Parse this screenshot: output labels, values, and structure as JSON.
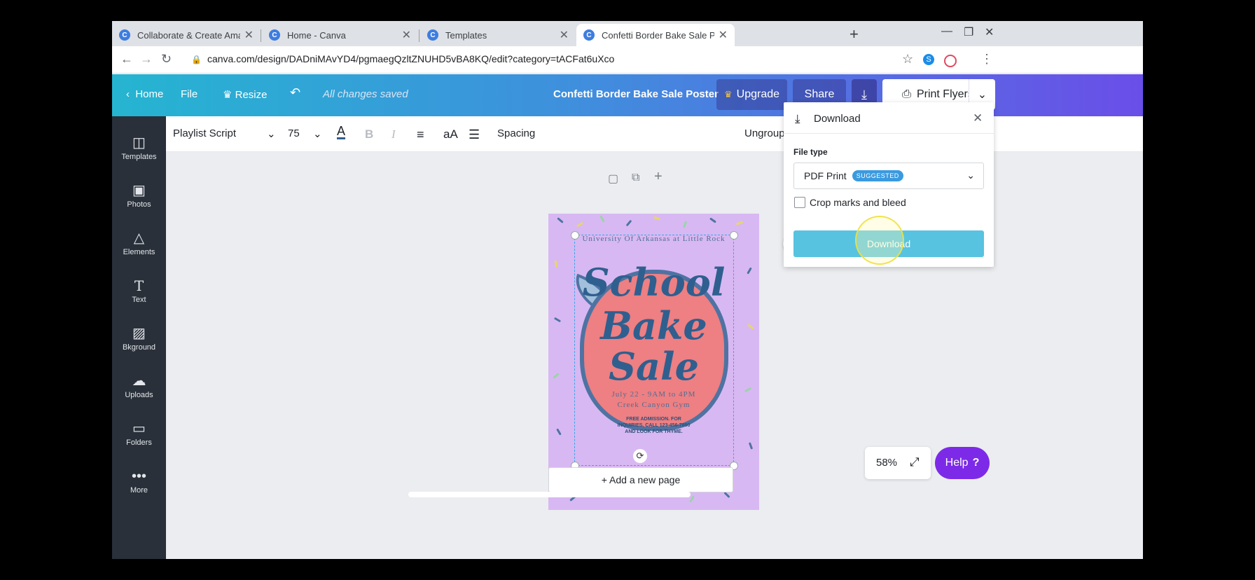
{
  "browser": {
    "tabs": [
      {
        "label": "Collaborate & Create Amazing G",
        "icon": "C"
      },
      {
        "label": "Home - Canva",
        "icon": "C"
      },
      {
        "label": "Templates",
        "icon": "C"
      },
      {
        "label": "Confetti Border Bake Sale Poster",
        "icon": "C"
      }
    ],
    "url": "canva.com/design/DADniMAvYD4/pgmaegQzltZNUHD5vBA8KQ/edit?category=tACFat6uXco"
  },
  "header": {
    "home": "Home",
    "file": "File",
    "resize": "Resize",
    "saved": "All changes saved",
    "doc_title": "Confetti Border Bake Sale Poster",
    "upgrade": "Upgrade",
    "share": "Share",
    "print": "Print Flyers"
  },
  "sidebar": {
    "items": [
      "Templates",
      "Photos",
      "Elements",
      "Text",
      "Bkground",
      "Uploads",
      "Folders",
      "More"
    ]
  },
  "toolbar": {
    "font": "Playlist Script",
    "size": "75",
    "spacing": "Spacing",
    "ungroup": "Ungroup",
    "case_label": "aA"
  },
  "poster": {
    "university": "University Of Arkansas at Little Rock",
    "word1": "School",
    "word2": "Bake",
    "word3": "Sale",
    "date": "July 22 - 9AM to 4PM",
    "place": "Creek Canyon Gym",
    "info1": "FREE ADMISSION. FOR",
    "info2": "INQUIRIES, CALL 123-456-7890",
    "info3": "AND LOOK FOR THYME."
  },
  "canvas": {
    "add_page": "+ Add a new page",
    "zoom": "58%",
    "help": "Help"
  },
  "download_panel": {
    "title": "Download",
    "file_type_label": "File type",
    "file_type": "PDF Print",
    "badge": "SUGGESTED",
    "crop_label": "Crop marks and bleed",
    "button": "Download"
  },
  "colors": {
    "accent": "#3e7de0",
    "download_button": "#57c3e0",
    "sidebar": "#293039",
    "help": "#7d2ae8"
  }
}
